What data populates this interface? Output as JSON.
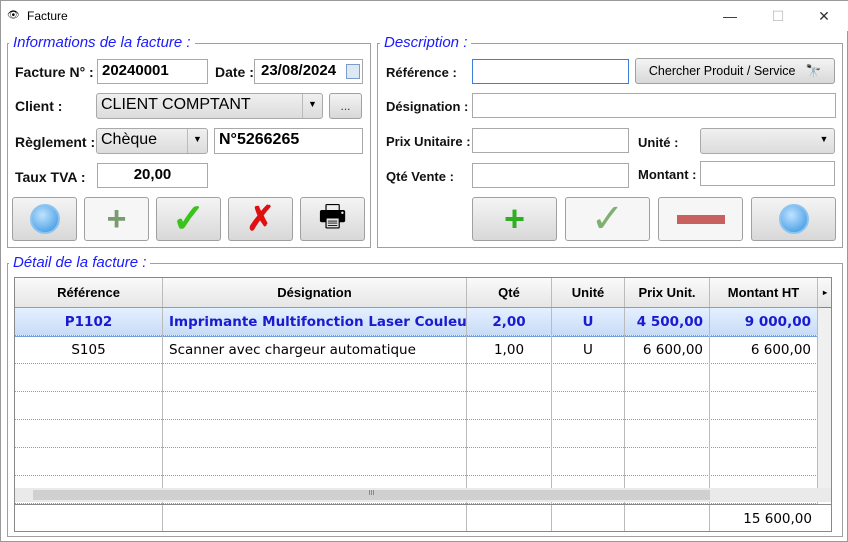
{
  "window": {
    "title": "Facture",
    "minimize": "—",
    "maximize": "☐",
    "close": "✕"
  },
  "info": {
    "legend": "Informations de la facture :",
    "facture_label": "Facture N° :",
    "facture_value": "20240001",
    "date_label": "Date :",
    "date_value": "23/08/2024",
    "client_label": "Client :",
    "client_value": "CLIENT COMPTANT",
    "client_more": "...",
    "reglement_label": "Règlement :",
    "reglement_value": "Chèque",
    "reglement_ref": "N°5266265",
    "tva_label": "Taux  TVA :",
    "tva_value": "20,00"
  },
  "desc": {
    "legend": "Description :",
    "reference_label": "Référence :",
    "reference_value": "",
    "search_button": "Chercher Produit / Service",
    "designation_label": "Désignation :",
    "designation_value": "",
    "prix_label": "Prix Unitaire :",
    "prix_value": "",
    "unite_label": "Unité :",
    "unite_value": "",
    "qte_label": "Qté Vente :",
    "qte_value": "",
    "montant_label": "Montant :",
    "montant_value": ""
  },
  "detail": {
    "legend": "Détail de la facture :",
    "columns": [
      "Référence",
      "Désignation",
      "Qté",
      "Unité",
      "Prix Unit.",
      "Montant HT"
    ],
    "rows": [
      [
        "P1102",
        "Imprimante Multifonction Laser Couleur",
        "2,00",
        "U",
        "4 500,00",
        "9 000,00"
      ],
      [
        "S105",
        "Scanner avec chargeur automatique",
        "1,00",
        "U",
        "6 600,00",
        "6 600,00"
      ]
    ],
    "total": "15 600,00",
    "selected_row": 0
  }
}
